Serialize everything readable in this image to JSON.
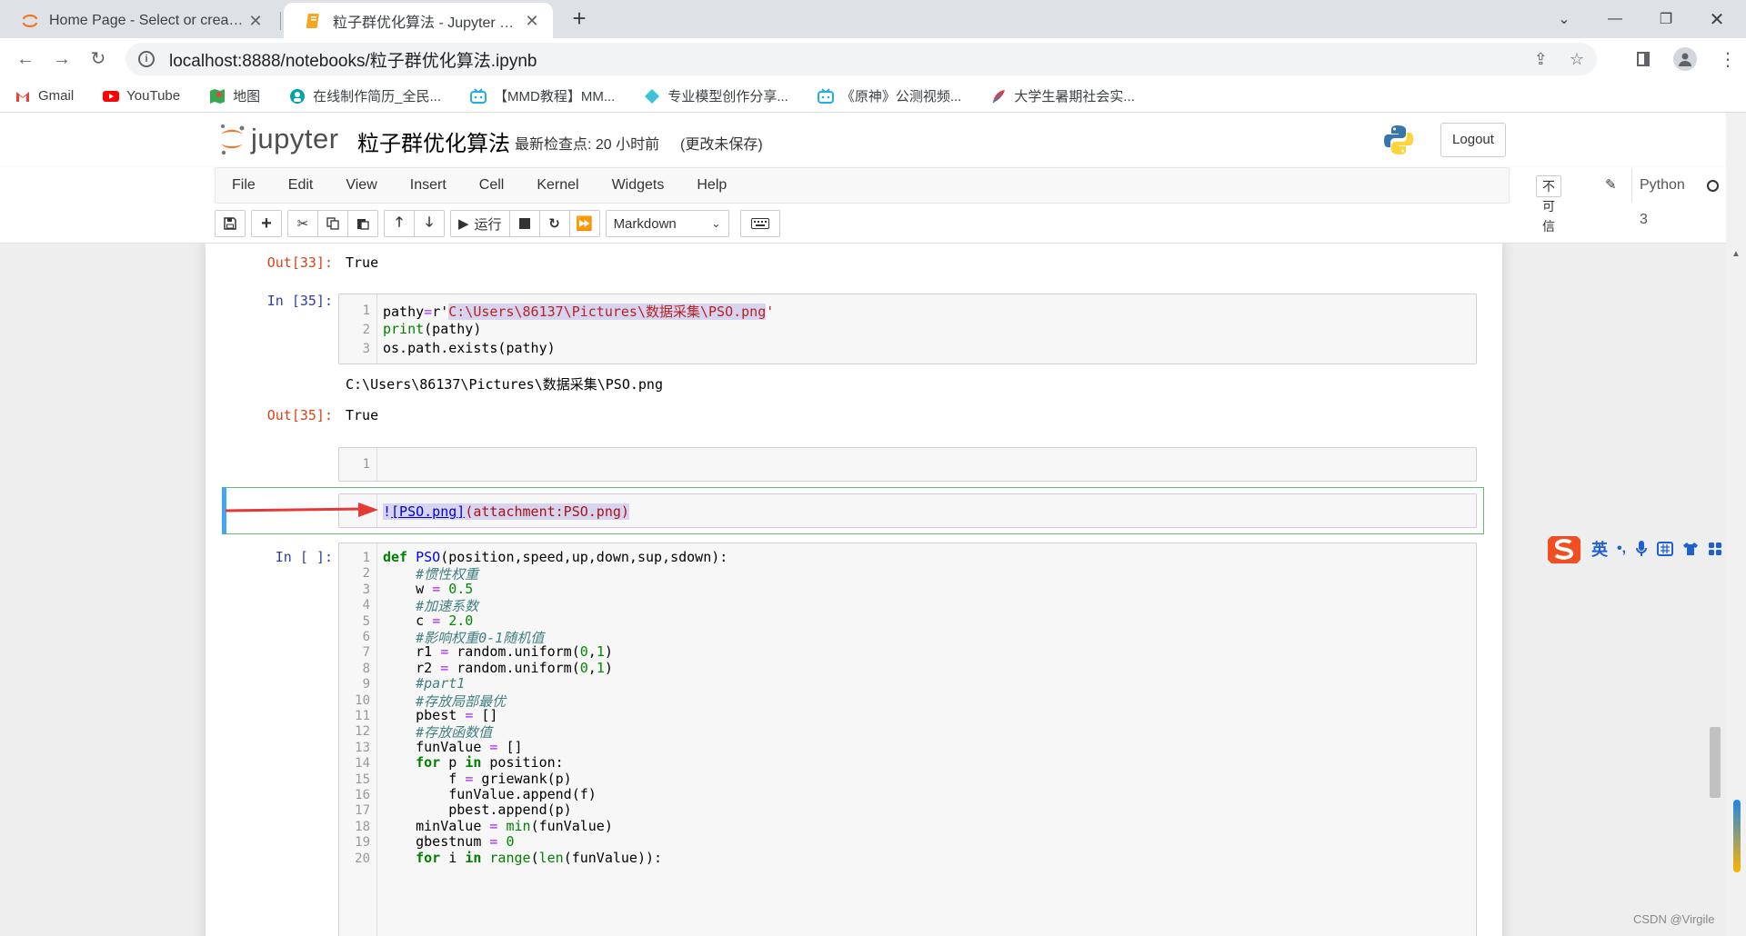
{
  "browser": {
    "tabs": [
      {
        "title": "Home Page - Select or create a notebook",
        "active": false
      },
      {
        "title": "粒子群优化算法 - Jupyter Notebook",
        "active": true
      }
    ],
    "url": "localhost:8888/notebooks/粒子群优化算法.ipynb",
    "bookmarks": [
      {
        "label": "Gmail",
        "color": "#ea4335"
      },
      {
        "label": "YouTube",
        "color": "#ff0000"
      },
      {
        "label": "地图",
        "color": "#34a853"
      },
      {
        "label": "在线制作简历_全民...",
        "color": "#00a4a6"
      },
      {
        "label": "【MMD教程】MM...",
        "color": "#23ade5"
      },
      {
        "label": "专业模型创作分享...",
        "color": "#3ec1d3"
      },
      {
        "label": "《原神》公测视频...",
        "color": "#23ade5"
      },
      {
        "label": "大学生暑期社会实...",
        "color": "#e53935"
      }
    ]
  },
  "jupyter": {
    "logo_text": "jupyter",
    "notebook_name": "粒子群优化算法",
    "checkpoint": "最新检查点: 20 小时前",
    "autosave": "(更改未保存)",
    "logout": "Logout",
    "menu": [
      "File",
      "Edit",
      "View",
      "Insert",
      "Cell",
      "Kernel",
      "Widgets",
      "Help"
    ],
    "trust": "不可信",
    "kernel": "Python 3",
    "run_label": "运行",
    "cell_type": "Markdown"
  },
  "cells": {
    "out33_prompt": "Out[33]:",
    "out33_text": "True",
    "in35_prompt": "In  [35]:",
    "in35_lines": [
      "pathy=r'C:\\Users\\86137\\Pictures\\数据采集\\PSO.png'",
      "print(pathy)",
      "os.path.exists(pathy)"
    ],
    "in35_stdout": "C:\\Users\\86137\\Pictures\\数据采集\\PSO.png",
    "out35_prompt": "Out[35]:",
    "out35_text": "True",
    "empty_line_num": "1",
    "markdown_text": "![PSO.png](attachment:PSO.png)",
    "pso_prompt": "In  [ ]:",
    "pso_lines": [
      "def PSO(position,speed,up,down,sup,sdown):",
      "    #惯性权重",
      "    w = 0.5",
      "    #加速系数",
      "    c = 2.0",
      "    #影响权重0-1随机值",
      "    r1 = random.uniform(0,1)",
      "    r2 = random.uniform(0,1)",
      "    #part1",
      "    #存放局部最优",
      "    pbest = []",
      "    #存放函数值",
      "    funValue = []",
      "    for p in position:",
      "        f = griewank(p)",
      "        funValue.append(f)",
      "        pbest.append(p)",
      "    minValue = min(funValue)",
      "    gbestnum = 0",
      "    for i in range(len(funValue)):"
    ]
  },
  "ime": {
    "label": "英"
  },
  "watermark": "CSDN @Virgile"
}
